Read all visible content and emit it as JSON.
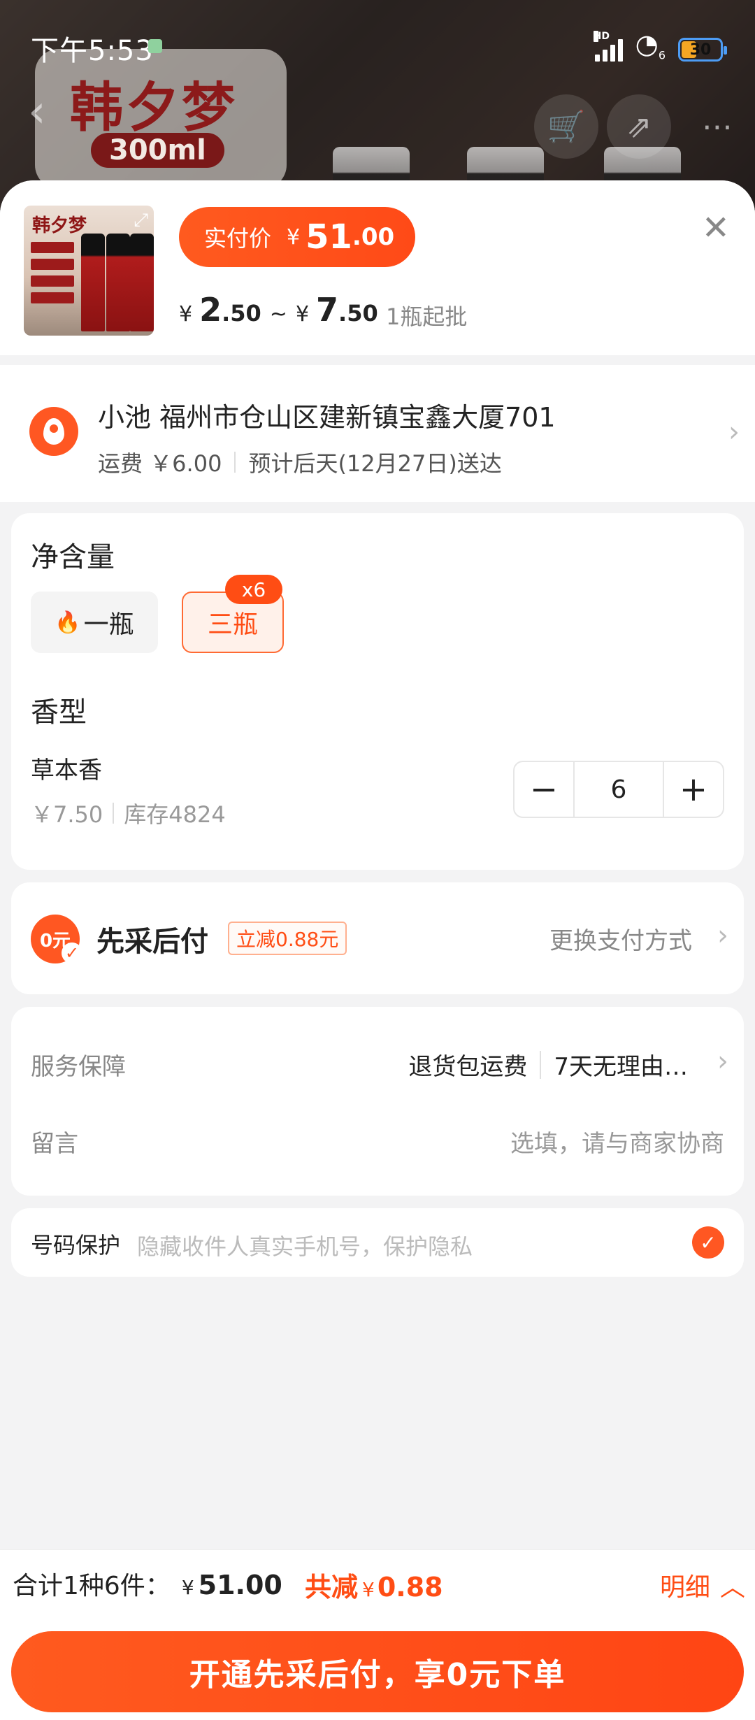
{
  "status_bar": {
    "time": "下午5:53",
    "signal_label": "HD",
    "wifi_label": "6",
    "battery": "30"
  },
  "background_page": {
    "brand": "韩夕梦",
    "volume": "300ml",
    "back_icon": "chevron-left-icon",
    "cart_icon": "cart-icon",
    "share_icon": "share-icon",
    "more_icon": "more-icon"
  },
  "header": {
    "thumb_brand": "韩夕梦",
    "actual_label": "实付价",
    "currency": "¥",
    "actual_int": "51",
    "actual_dec": ".00",
    "range_low_int": "2",
    "range_low_dec": ".50",
    "range_sep": "~",
    "range_high_int": "7",
    "range_high_dec": ".50",
    "min_order": "1瓶起批",
    "close_icon": "close-icon"
  },
  "address": {
    "line": "小池 福州市仓山区建新镇宝鑫大厦701",
    "shipping": "运费 ￥6.00",
    "delivery": "预计后天(12月27日)送达"
  },
  "spec": {
    "title": "净含量",
    "options": [
      {
        "label": "一瓶",
        "hot": true,
        "selected": false
      },
      {
        "label": "三瓶",
        "badge": "x6",
        "selected": true
      }
    ],
    "scent_title": "香型",
    "scent_name": "草本香",
    "scent_price": "￥7.50",
    "scent_stock": "库存4824",
    "quantity": "6",
    "minus": "−",
    "plus": "+"
  },
  "payment": {
    "badge_text": "0元",
    "title": "先采后付",
    "tag": "立减0.88元",
    "change": "更换支付方式"
  },
  "service": {
    "label": "服务保障",
    "item1": "退货包运费",
    "item2": "7天无理由…",
    "msg_label": "留言",
    "msg_placeholder": "选填，请与商家协商"
  },
  "phone": {
    "label": "号码保护",
    "hint": "隐藏收件人真实手机号，保护隐私",
    "checked": true
  },
  "footer": {
    "total_label": "合计1种6件：",
    "total_currency": "¥",
    "total_amount": "51.00",
    "saved_label": "共减",
    "saved_currency": "¥",
    "saved_amount": "0.88",
    "detail": "明细",
    "submit": "开通先采后付，享0元下单"
  },
  "colors": {
    "accent": "#ff4d14",
    "accent_light": "#fff1ea"
  }
}
